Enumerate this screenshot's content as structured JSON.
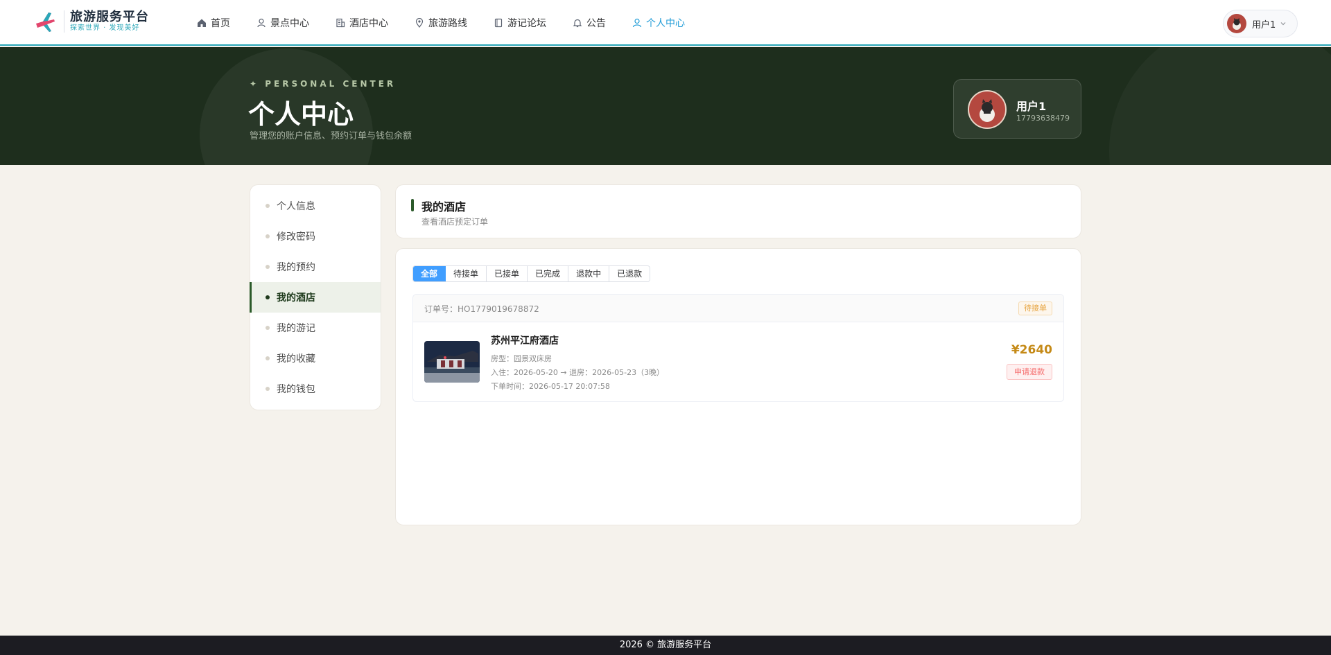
{
  "brand": {
    "title": "旅游服务平台",
    "subtitle": "探索世界 · 发现美好",
    "accent": "#2aa7b8"
  },
  "nav": {
    "items": [
      {
        "label": "首页",
        "icon": "home-icon"
      },
      {
        "label": "景点中心",
        "icon": "person-pin-icon"
      },
      {
        "label": "酒店中心",
        "icon": "building-icon"
      },
      {
        "label": "旅游路线",
        "icon": "location-icon"
      },
      {
        "label": "游记论坛",
        "icon": "notebook-icon"
      },
      {
        "label": "公告",
        "icon": "bell-icon"
      },
      {
        "label": "个人中心",
        "icon": "user-icon",
        "active": true
      }
    ],
    "active_color": "#1e9bd7"
  },
  "user": {
    "name": "用户1",
    "phone": "17793638479"
  },
  "hero": {
    "eyebrow": "✦ PERSONAL CENTER",
    "title": "个人中心",
    "subtitle": "管理您的账户信息、预约订单与钱包余额"
  },
  "sidebar": {
    "items": [
      {
        "label": "个人信息"
      },
      {
        "label": "修改密码"
      },
      {
        "label": "我的预约"
      },
      {
        "label": "我的酒店",
        "active": true
      },
      {
        "label": "我的游记"
      },
      {
        "label": "我的收藏"
      },
      {
        "label": "我的钱包"
      }
    ]
  },
  "section": {
    "title": "我的酒店",
    "subtitle": "查看酒店预定订单"
  },
  "tabs": [
    {
      "label": "全部",
      "active": true
    },
    {
      "label": "待接单"
    },
    {
      "label": "已接单"
    },
    {
      "label": "已完成"
    },
    {
      "label": "退款中"
    },
    {
      "label": "已退款"
    }
  ],
  "orders": [
    {
      "order_no": "订单号：HO1779019678872",
      "status": "待接单",
      "hotel_name": "苏州平江府酒店",
      "room": "房型：园景双床房",
      "dates": "入住：2026-05-20 → 退房：2026-05-23（3晚）",
      "created": "下单时间：2026-05-17 20:07:58",
      "price": "¥2640",
      "action": "申请退款"
    }
  ],
  "footer": {
    "text": "2026 © 旅游服务平台"
  }
}
